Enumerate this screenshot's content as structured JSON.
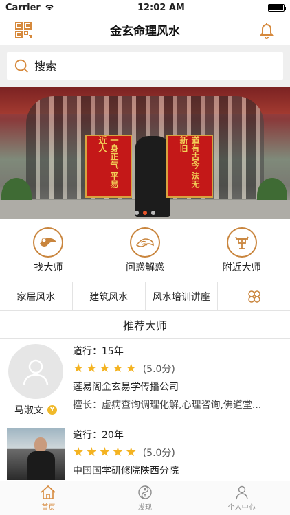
{
  "status": {
    "carrier": "Carrier",
    "time": "12:02 AM"
  },
  "nav": {
    "title": "金玄命理风水",
    "left_icon": "qrcode-icon",
    "right_icon": "bell-icon",
    "accent": "#d6893c"
  },
  "search": {
    "placeholder": "搜索"
  },
  "banner": {
    "flag_left": "一身正气 平易近人",
    "flag_right": "道有古今 法无新旧",
    "dots_count": 3,
    "active_dot": 1
  },
  "features": [
    {
      "label": "找大师",
      "icon": "hand-icon"
    },
    {
      "label": "问惑解惑",
      "icon": "palm-icon"
    },
    {
      "label": "附近大师",
      "icon": "location-pin-icon"
    }
  ],
  "categories": [
    "家居风水",
    "建筑风水",
    "风水培训讲座"
  ],
  "category_more_icon": "clover-grid-icon",
  "section_title": "推荐大师",
  "masters": [
    {
      "name": "马淑文",
      "experience": "道行：15年",
      "rating_stars": 5,
      "score": "(5.0分)",
      "company": "莲易阁金玄易学传播公司",
      "specialty": "擅长：虚病查询调理化解,心理咨询,佛道堂..."
    },
    {
      "name": "",
      "experience": "道行：20年",
      "rating_stars": 5,
      "score": "(5.0分)",
      "company": "中国国学研修院陕西分院",
      "specialty": ""
    }
  ],
  "tabs": [
    {
      "label": "首页",
      "icon": "home-icon",
      "active": true
    },
    {
      "label": "发现",
      "icon": "yin-yang-icon",
      "active": false
    },
    {
      "label": "个人中心",
      "icon": "person-icon",
      "active": false
    }
  ]
}
